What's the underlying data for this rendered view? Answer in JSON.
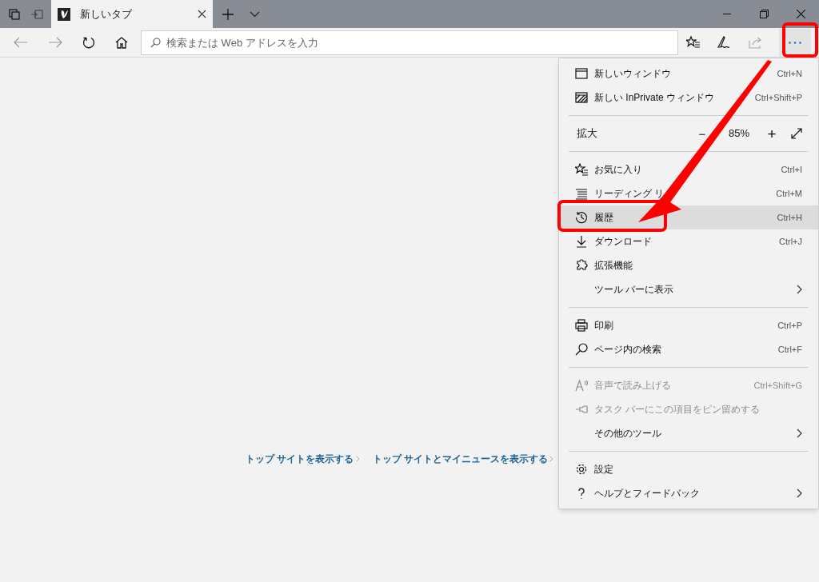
{
  "tab": {
    "title": "新しいタブ",
    "selected": true
  },
  "address_bar": {
    "placeholder": "検索または Web アドレスを入力"
  },
  "menu": {
    "sections": [
      [
        {
          "kind": "item",
          "label": "新しいウィンドウ",
          "shortcut": "Ctrl+N",
          "disabled": false,
          "selected": false
        },
        {
          "kind": "item",
          "label": "新しい InPrivate ウィンドウ",
          "shortcut": "Ctrl+Shift+P",
          "disabled": false,
          "selected": false
        }
      ],
      [
        {
          "kind": "zoom",
          "label": "拡大",
          "minus": "−",
          "value": "85%",
          "plus": "+"
        }
      ],
      [
        {
          "kind": "item",
          "label": "お気に入り",
          "shortcut": "Ctrl+I",
          "disabled": false,
          "selected": false
        },
        {
          "kind": "item",
          "label": "リーディング リ",
          "shortcut": "Ctrl+M",
          "disabled": false,
          "selected": false
        },
        {
          "kind": "item",
          "label": "履歴",
          "shortcut": "Ctrl+H",
          "disabled": false,
          "selected": true
        },
        {
          "kind": "item",
          "label": "ダウンロード",
          "shortcut": "Ctrl+J",
          "disabled": false,
          "selected": false
        },
        {
          "kind": "item",
          "label": "拡張機能",
          "disabled": false,
          "selected": false
        },
        {
          "kind": "item",
          "label": "ツール バーに表示",
          "submenu": true,
          "disabled": false,
          "selected": false
        }
      ],
      [
        {
          "kind": "item",
          "label": "印刷",
          "shortcut": "Ctrl+P",
          "disabled": false,
          "selected": false
        },
        {
          "kind": "item",
          "label": "ページ内の検索",
          "shortcut": "Ctrl+F",
          "disabled": false,
          "selected": false
        }
      ],
      [
        {
          "kind": "item",
          "label": "音声で読み上げる",
          "shortcut": "Ctrl+Shift+G",
          "disabled": true,
          "selected": false
        },
        {
          "kind": "item",
          "label": "タスク バーにこの項目をピン留めする",
          "disabled": true,
          "selected": false
        },
        {
          "kind": "item",
          "label": "その他のツール",
          "submenu": true,
          "disabled": false,
          "selected": false
        }
      ],
      [
        {
          "kind": "item",
          "label": "設定",
          "disabled": false,
          "selected": false
        },
        {
          "kind": "item",
          "label": "ヘルプとフィードバック",
          "submenu": true,
          "disabled": false,
          "selected": false
        }
      ]
    ]
  },
  "links": [
    "トップ サイトを表示する",
    "トップ サイトとマイニュースを表示する"
  ]
}
